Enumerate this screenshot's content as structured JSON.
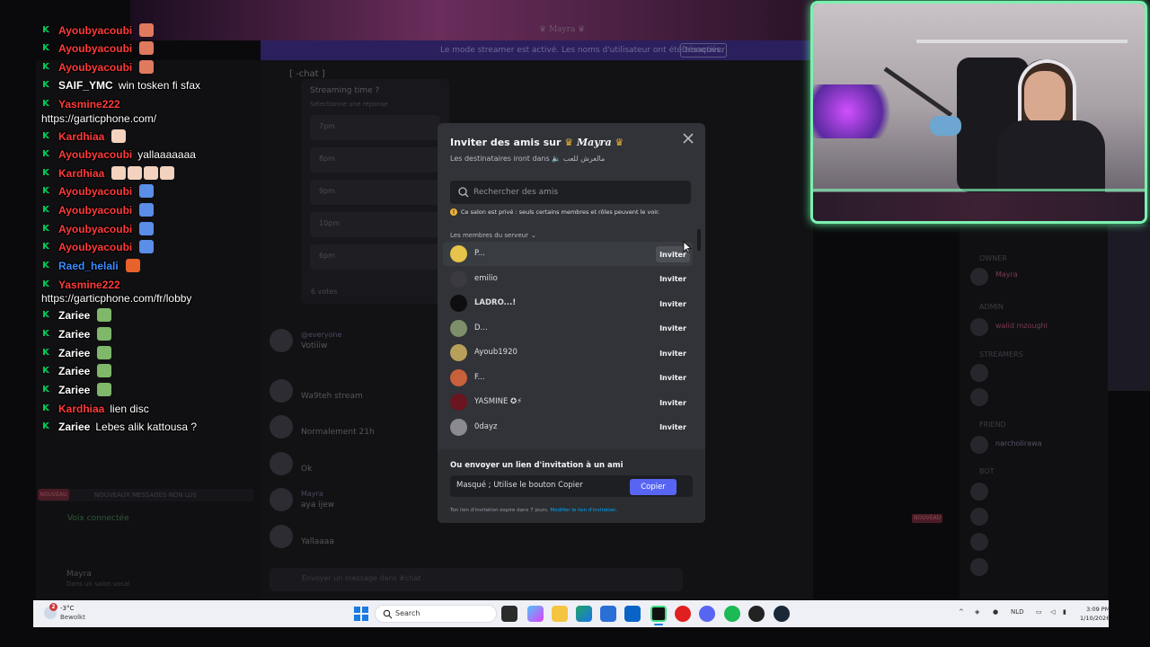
{
  "modal": {
    "title_prefix": "Inviter des amis sur",
    "server_name": "Mayra",
    "subtitle_prefix": "Les destinataires iront dans",
    "channel_name": "مالعرش للعب",
    "search_placeholder": "Rechercher des amis",
    "warning": "Ce salon est privé : seuls certains membres et rôles peuvent le voir.",
    "section_label": "Les membres du serveur",
    "invite_label": "Inviter",
    "members": [
      {
        "name": "P...",
        "avatar_color": "#e6c34a",
        "bold": false
      },
      {
        "name": "emilio",
        "avatar_color": "#3a3a40",
        "bold": false
      },
      {
        "name": "LADRO...!",
        "avatar_color": "#0e0e10",
        "bold": true
      },
      {
        "name": "D...",
        "avatar_color": "#7c8f6a",
        "bold": false
      },
      {
        "name": "Ayoub1920",
        "avatar_color": "#b8a05a",
        "bold": false
      },
      {
        "name": "F...",
        "avatar_color": "#c9603c",
        "bold": false
      },
      {
        "name": "YASMINE ✪⚡",
        "avatar_color": "#6a1520",
        "bold": false
      },
      {
        "name": "0dayz",
        "avatar_color": "#8a8a90",
        "bold": false
      }
    ],
    "footer_title": "Ou envoyer un lien d'invitation à un ami",
    "link_value": "Masqué ; Utilise le bouton Copier",
    "copy_label": "Copier",
    "footer_note": "Ton lien d'invitation expire dans 7 jours.",
    "footer_link": "Modifier le lien d'invitation."
  },
  "stream_chat": [
    {
      "user": "Ayoubyacoubi",
      "color": "#ff3b3b",
      "msg": "",
      "emotes": [
        "#e07a5f"
      ]
    },
    {
      "user": "Ayoubyacoubi",
      "color": "#ff3b3b",
      "msg": "",
      "emotes": [
        "#e07a5f"
      ]
    },
    {
      "user": "Ayoubyacoubi",
      "color": "#ff3b3b",
      "msg": "",
      "emotes": [
        "#e07a5f"
      ]
    },
    {
      "user": "SAIF_YMC",
      "color": "#ffffff",
      "msg": "win tosken fi sfax",
      "emotes": []
    },
    {
      "user": "Yasmine222",
      "color": "#ff3b3b",
      "msg": "",
      "emotes": []
    },
    {
      "user": "",
      "color": "#ffffff",
      "msg": "https://garticphone.com/",
      "emotes": []
    },
    {
      "user": "Kardhiaa",
      "color": "#ff3b3b",
      "msg": "",
      "emotes": [
        "#f3d2c0"
      ]
    },
    {
      "user": "Ayoubyacoubi",
      "color": "#ff3b3b",
      "msg": "yallaaaaaaa",
      "emotes": []
    },
    {
      "user": "Kardhiaa",
      "color": "#ff3b3b",
      "msg": "",
      "emotes": [
        "#f3d2c0",
        "#f3d2c0",
        "#f3d2c0",
        "#f3d2c0"
      ]
    },
    {
      "user": "Ayoubyacoubi",
      "color": "#ff3b3b",
      "msg": "",
      "emotes": [
        "#5a8ee8"
      ]
    },
    {
      "user": "Ayoubyacoubi",
      "color": "#ff3b3b",
      "msg": "",
      "emotes": [
        "#5a8ee8"
      ]
    },
    {
      "user": "Ayoubyacoubi",
      "color": "#ff3b3b",
      "msg": "",
      "emotes": [
        "#5a8ee8"
      ]
    },
    {
      "user": "Ayoubyacoubi",
      "color": "#ff3b3b",
      "msg": "",
      "emotes": [
        "#5a8ee8"
      ]
    },
    {
      "user": "Raed_helali",
      "color": "#3a8cff",
      "msg": "",
      "emotes": [
        "#e8622c"
      ]
    },
    {
      "user": "Yasmine222",
      "color": "#ff3b3b",
      "msg": "",
      "emotes": []
    },
    {
      "user": "",
      "color": "#ffffff",
      "msg": "https://garticphone.com/fr/lobby",
      "emotes": []
    },
    {
      "user": "Zariee",
      "color": "#ffffff",
      "msg": "",
      "emotes": [
        "#7fb86a"
      ]
    },
    {
      "user": "Zariee",
      "color": "#ffffff",
      "msg": "",
      "emotes": [
        "#7fb86a"
      ]
    },
    {
      "user": "Zariee",
      "color": "#ffffff",
      "msg": "",
      "emotes": [
        "#7fb86a"
      ]
    },
    {
      "user": "Zariee",
      "color": "#ffffff",
      "msg": "",
      "emotes": [
        "#7fb86a"
      ]
    },
    {
      "user": "Zariee",
      "color": "#ffffff",
      "msg": "",
      "emotes": [
        "#7fb86a"
      ]
    },
    {
      "user": "Kardhiaa",
      "color": "#ff3b3b",
      "msg": "lien disc",
      "emotes": []
    },
    {
      "user": "Zariee",
      "color": "#ffffff",
      "msg": "Lebes alik kattousa ?",
      "emotes": []
    }
  ],
  "background": {
    "banner_text": "Le mode streamer est activé. Les noms d'utilisateur ont été tronqués.",
    "banner_button": "Désactiver",
    "server_title": "Mayra",
    "channel_header": "chat",
    "poll_question": "Streaming time ?",
    "poll_sub": "Sélectionne une réponse",
    "poll_options": [
      "7pm",
      "8pm",
      "9pm",
      "10pm",
      "6pm"
    ],
    "poll_votes": "6 votes",
    "messages": [
      {
        "name": "@everyone",
        "text": "Votiiiw"
      },
      {
        "name": "",
        "text": "Wa9teh stream"
      },
      {
        "name": "",
        "text": "Normalement 21h"
      },
      {
        "name": "",
        "text": "Ok"
      },
      {
        "name": "Mayra",
        "text": "aya ijew"
      },
      {
        "name": "",
        "text": "Yallaaaa"
      }
    ],
    "new_messages": "NOUVEAUX MESSAGES NON LUS",
    "new_pill": "NOUVEAU",
    "voice_connected": "Voix connectée",
    "user_name": "Mayra",
    "user_status": "Dans un salon vocal",
    "right_sections": [
      {
        "label": "OWNER",
        "name": "Mayra",
        "color": "#b04a6a"
      },
      {
        "label": "ADMIN",
        "name": "walid mzoughi",
        "color": "#b04a6a"
      },
      {
        "label": "STREAMERS",
        "name": "",
        "color": "#3a7a4a"
      },
      {
        "label": "FRIEND",
        "name": "narcholirawa",
        "color": "#8a8aa0"
      },
      {
        "label": "BOT",
        "name": "",
        "color": "#5a5ab0"
      }
    ],
    "nouveau_tag": "NOUVEAU"
  },
  "taskbar": {
    "weather_temp": "-3°C",
    "weather_desc": "Bewolkt",
    "weather_badge": "2",
    "search_label": "Search",
    "language": "NLD",
    "time": "3:09 PM",
    "date": "1/10/2026",
    "apps": [
      "file-explorer",
      "copilot",
      "folder",
      "edge",
      "store",
      "outlook",
      "discord",
      "opera",
      "messenger",
      "spotify",
      "obs",
      "steam"
    ]
  },
  "colors": {
    "modal_bg": "#313338",
    "accent": "#5865f2",
    "cam_border": "#7cf0b0"
  }
}
